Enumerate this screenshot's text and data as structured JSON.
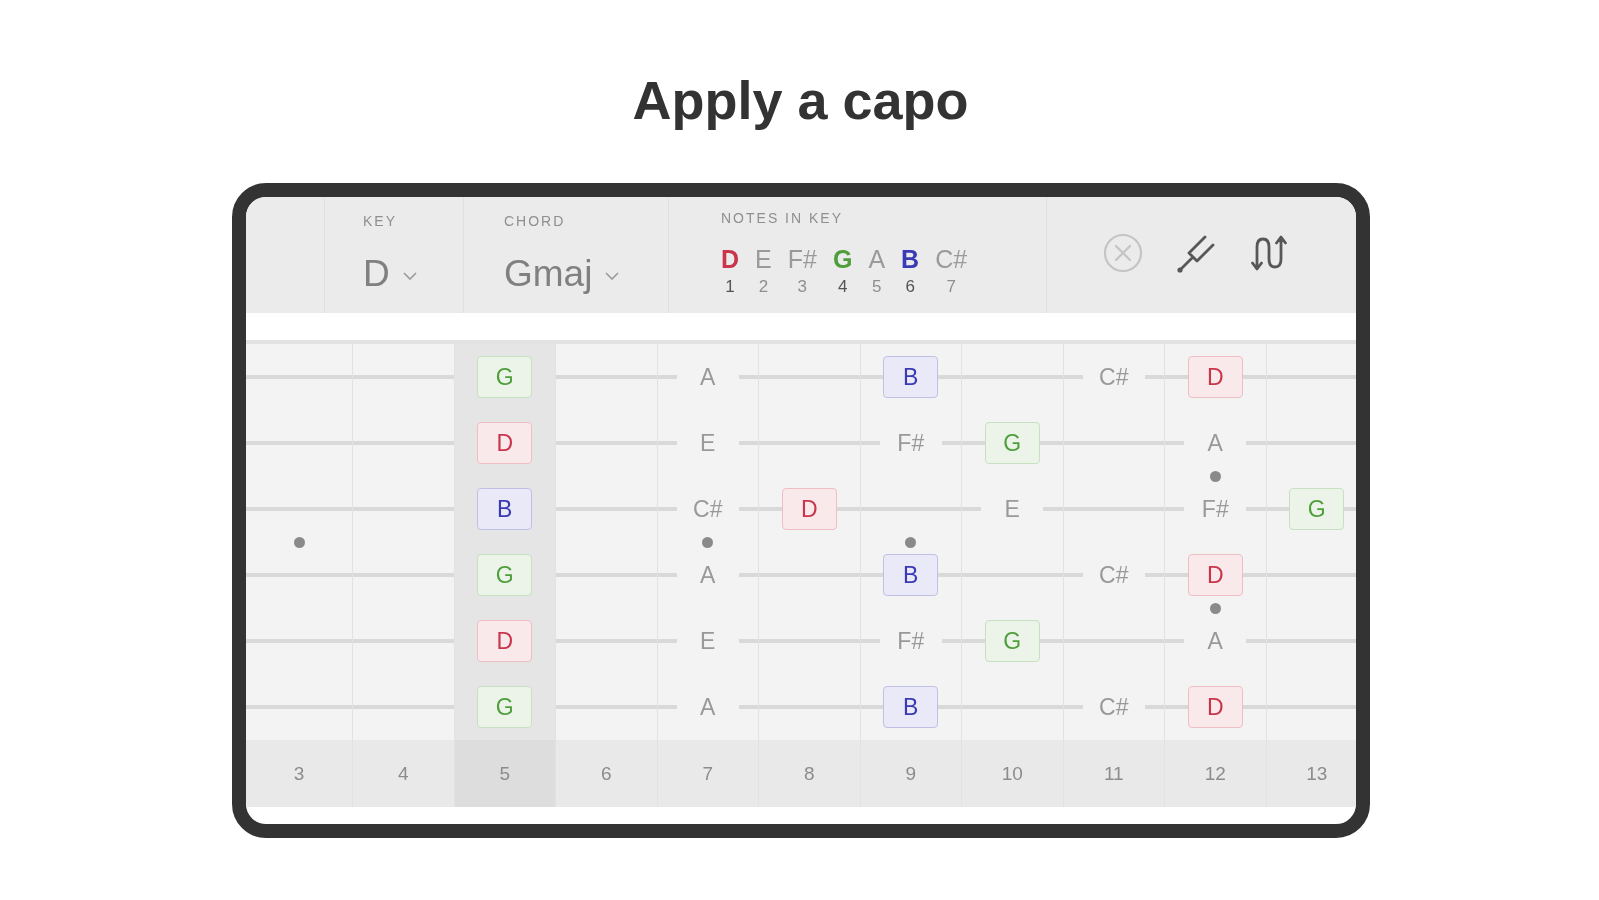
{
  "title": "Apply a capo",
  "header": {
    "key": {
      "label": "KEY",
      "value": "D"
    },
    "chord": {
      "label": "CHORD",
      "value": "Gmaj"
    },
    "notes_in_key": {
      "label": "NOTES IN KEY",
      "notes": [
        {
          "note": "D",
          "degree": "1",
          "in_chord": true,
          "color": "#c9354a"
        },
        {
          "note": "E",
          "degree": "2",
          "in_chord": false
        },
        {
          "note": "F#",
          "degree": "3",
          "in_chord": false
        },
        {
          "note": "G",
          "degree": "4",
          "in_chord": true,
          "color": "#4e9e3a"
        },
        {
          "note": "A",
          "degree": "5",
          "in_chord": false
        },
        {
          "note": "B",
          "degree": "6",
          "in_chord": true,
          "color": "#3a3ab5"
        },
        {
          "note": "C#",
          "degree": "7",
          "in_chord": false
        }
      ]
    },
    "tools": [
      {
        "kind": "clear",
        "disabled": true
      },
      {
        "kind": "tuner",
        "disabled": false
      },
      {
        "kind": "flip",
        "disabled": false
      }
    ]
  },
  "fretboard": {
    "frets": [
      {
        "number": "3",
        "selected": false,
        "kind": "dot"
      },
      {
        "number": "4",
        "selected": false,
        "kind": "plain"
      },
      {
        "number": "5",
        "selected": true,
        "kind": "plain"
      },
      {
        "number": "6",
        "selected": false,
        "kind": "plain"
      },
      {
        "number": "7",
        "selected": false,
        "kind": "dot"
      },
      {
        "number": "8",
        "selected": false,
        "kind": "plain"
      },
      {
        "number": "9",
        "selected": false,
        "kind": "dot"
      },
      {
        "number": "10",
        "selected": false,
        "kind": "plain"
      },
      {
        "number": "11",
        "selected": false,
        "kind": "plain"
      },
      {
        "number": "12",
        "selected": false,
        "kind": "double_dot"
      },
      {
        "number": "13",
        "selected": false,
        "kind": "plain"
      }
    ],
    "strings": [
      {
        "cells": [
          {
            "kind": "blank"
          },
          {
            "kind": "blank"
          },
          {
            "kind": "chord",
            "note": "G",
            "color": "#4e9e3a"
          },
          {
            "kind": "blank"
          },
          {
            "kind": "scale",
            "note": "A"
          },
          {
            "kind": "blank"
          },
          {
            "kind": "chord",
            "note": "B",
            "color": "#3a3ab5"
          },
          {
            "kind": "blank"
          },
          {
            "kind": "scale",
            "note": "C#"
          },
          {
            "kind": "chord",
            "note": "D",
            "color": "#c9354a"
          },
          {
            "kind": "blank"
          }
        ]
      },
      {
        "cells": [
          {
            "kind": "blank"
          },
          {
            "kind": "blank"
          },
          {
            "kind": "chord",
            "note": "D",
            "color": "#c9354a"
          },
          {
            "kind": "blank"
          },
          {
            "kind": "scale",
            "note": "E"
          },
          {
            "kind": "blank"
          },
          {
            "kind": "scale",
            "note": "F#"
          },
          {
            "kind": "chord",
            "note": "G",
            "color": "#4e9e3a"
          },
          {
            "kind": "blank"
          },
          {
            "kind": "scale",
            "note": "A"
          },
          {
            "kind": "blank"
          }
        ]
      },
      {
        "cells": [
          {
            "kind": "blank"
          },
          {
            "kind": "blank"
          },
          {
            "kind": "chord",
            "note": "B",
            "color": "#3a3ab5"
          },
          {
            "kind": "blank"
          },
          {
            "kind": "scale",
            "note": "C#"
          },
          {
            "kind": "chord",
            "note": "D",
            "color": "#c9354a"
          },
          {
            "kind": "blank"
          },
          {
            "kind": "scale",
            "note": "E"
          },
          {
            "kind": "blank"
          },
          {
            "kind": "scale",
            "note": "F#"
          },
          {
            "kind": "chord",
            "note": "G",
            "color": "#4e9e3a"
          }
        ]
      },
      {
        "cells": [
          {
            "kind": "blank"
          },
          {
            "kind": "blank"
          },
          {
            "kind": "chord",
            "note": "G",
            "color": "#4e9e3a"
          },
          {
            "kind": "blank"
          },
          {
            "kind": "scale",
            "note": "A"
          },
          {
            "kind": "blank"
          },
          {
            "kind": "chord",
            "note": "B",
            "color": "#3a3ab5"
          },
          {
            "kind": "blank"
          },
          {
            "kind": "scale",
            "note": "C#"
          },
          {
            "kind": "chord",
            "note": "D",
            "color": "#c9354a"
          },
          {
            "kind": "blank"
          }
        ]
      },
      {
        "cells": [
          {
            "kind": "blank"
          },
          {
            "kind": "blank"
          },
          {
            "kind": "chord",
            "note": "D",
            "color": "#c9354a"
          },
          {
            "kind": "blank"
          },
          {
            "kind": "scale",
            "note": "E"
          },
          {
            "kind": "blank"
          },
          {
            "kind": "scale",
            "note": "F#"
          },
          {
            "kind": "chord",
            "note": "G",
            "color": "#4e9e3a"
          },
          {
            "kind": "blank"
          },
          {
            "kind": "scale",
            "note": "A"
          },
          {
            "kind": "blank"
          }
        ]
      },
      {
        "cells": [
          {
            "kind": "blank"
          },
          {
            "kind": "blank"
          },
          {
            "kind": "chord",
            "note": "G",
            "color": "#4e9e3a"
          },
          {
            "kind": "blank"
          },
          {
            "kind": "scale",
            "note": "A"
          },
          {
            "kind": "blank"
          },
          {
            "kind": "chord",
            "note": "B",
            "color": "#3a3ab5"
          },
          {
            "kind": "blank"
          },
          {
            "kind": "scale",
            "note": "C#"
          },
          {
            "kind": "chord",
            "note": "D",
            "color": "#c9354a"
          },
          {
            "kind": "blank"
          }
        ]
      }
    ]
  }
}
